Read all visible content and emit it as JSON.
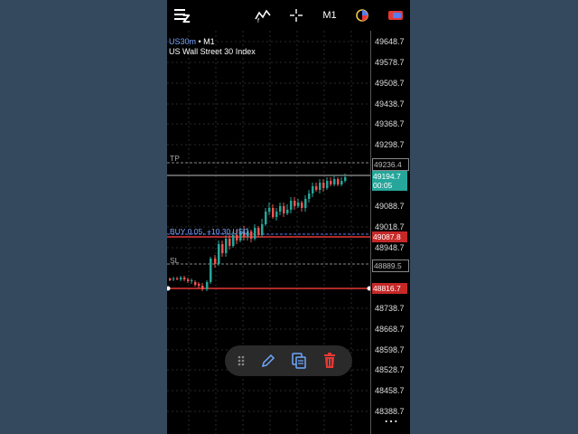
{
  "toolbar": {
    "timeframe": "M1",
    "icons": [
      "menu-icon",
      "indicators-icon",
      "crosshair-icon",
      "timeframe-label",
      "objects-icon",
      "trade-icon"
    ]
  },
  "symbol": {
    "code": "US30m",
    "timeframe": "• M1",
    "description": "US Wall Street 30 Index"
  },
  "price_axis": {
    "ticks": [
      "49648.7",
      "49578.7",
      "49508.7",
      "49438.7",
      "49368.7",
      "49298.7",
      "49088.7",
      "49018.7",
      "48948.7",
      "48738.7",
      "48668.7",
      "48598.7",
      "48528.7",
      "48458.7",
      "48388.7"
    ]
  },
  "levels": {
    "tp": {
      "label": "TP",
      "price": "49236.4"
    },
    "current": {
      "price": "49194.7",
      "timer": "00:05"
    },
    "buy": {
      "label": "BUY 0.05, +10.30 USD",
      "price": "49087.8"
    },
    "sl": {
      "label": "SL",
      "price": "48889.5"
    },
    "bid_red": {
      "price": "48816.7"
    }
  },
  "bottom_tools": {
    "icons": [
      "drag-handle-icon",
      "edit-icon",
      "copy-icon",
      "delete-icon"
    ]
  },
  "overflow": {
    "label": "⋯"
  },
  "colors": {
    "up": "#26a69a",
    "down": "#ef5350",
    "current_tag": "#26a69a",
    "buy_line": "#e53935",
    "sl_line": "#e53935"
  }
}
